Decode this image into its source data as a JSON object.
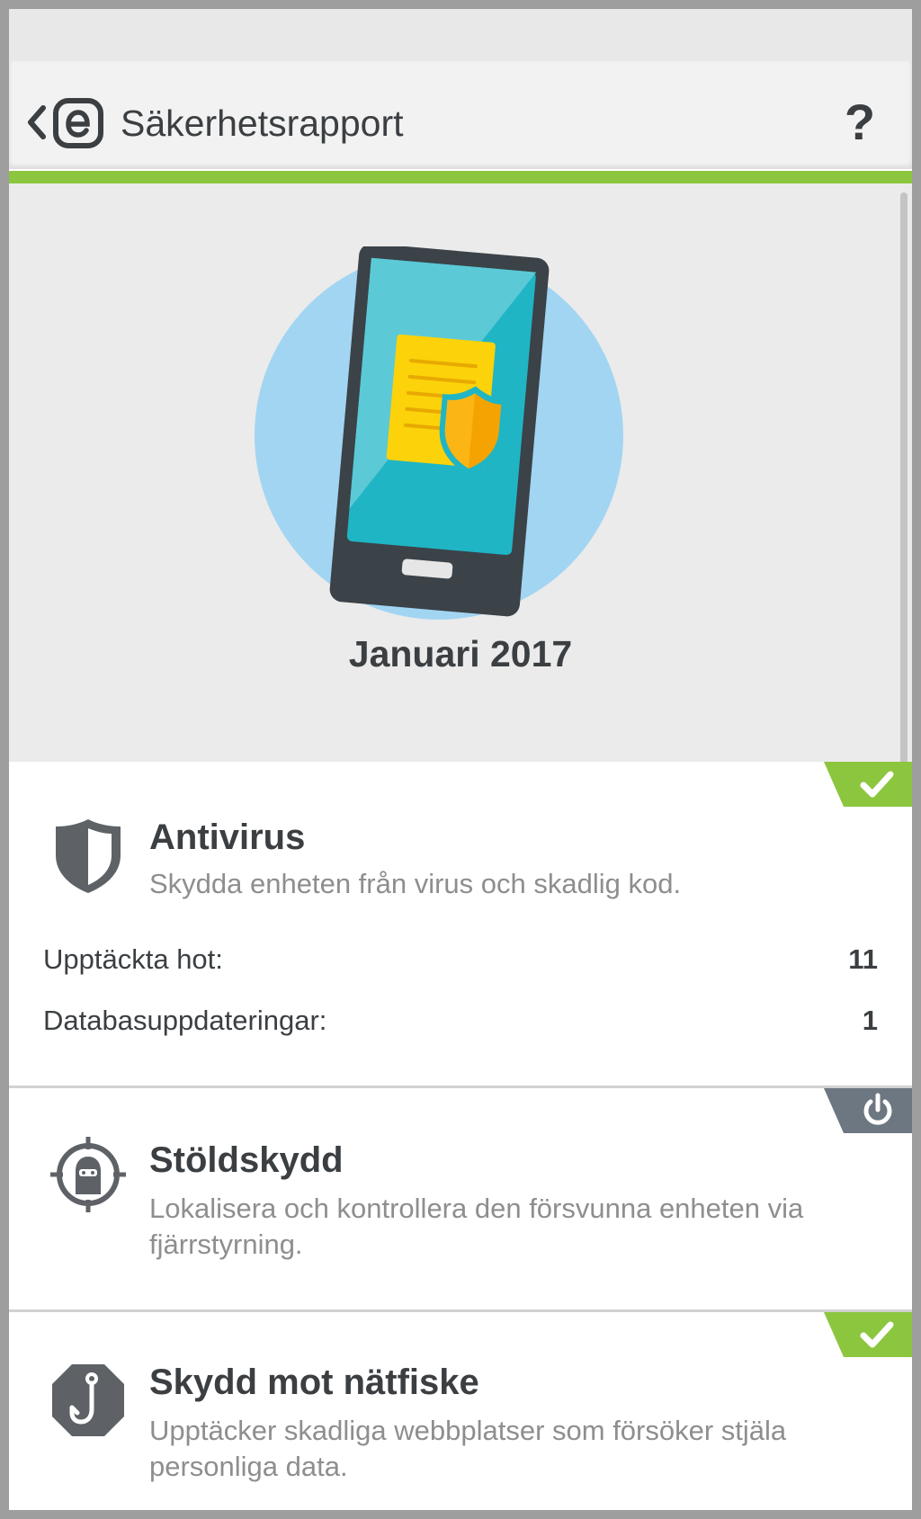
{
  "app": {
    "title": "Säkerhetsrapport",
    "help_label": "?"
  },
  "report": {
    "month": "Januari 2017"
  },
  "colors": {
    "accent": "#8cc63f",
    "status_ok": "#8cc63f",
    "status_off": "#6c7781"
  },
  "cards": [
    {
      "title": "Antivirus",
      "description": "Skydda enheten från virus och skadlig kod.",
      "status": "ok",
      "icon": "shield-icon",
      "stats": [
        {
          "label": "Upptäckta hot:",
          "value": "11"
        },
        {
          "label": "Databasuppdateringar:",
          "value": "1"
        }
      ]
    },
    {
      "title": "Stöldskydd",
      "description": "Lokalisera och kontrollera den försvunna enheten via fjärrstyrning.",
      "status": "off",
      "icon": "thief-target-icon"
    },
    {
      "title": "Skydd mot nätfiske",
      "description": "Upptäcker skadliga webbplatser som försöker stjäla personliga data.",
      "status": "ok",
      "icon": "fishing-hook-icon"
    }
  ]
}
